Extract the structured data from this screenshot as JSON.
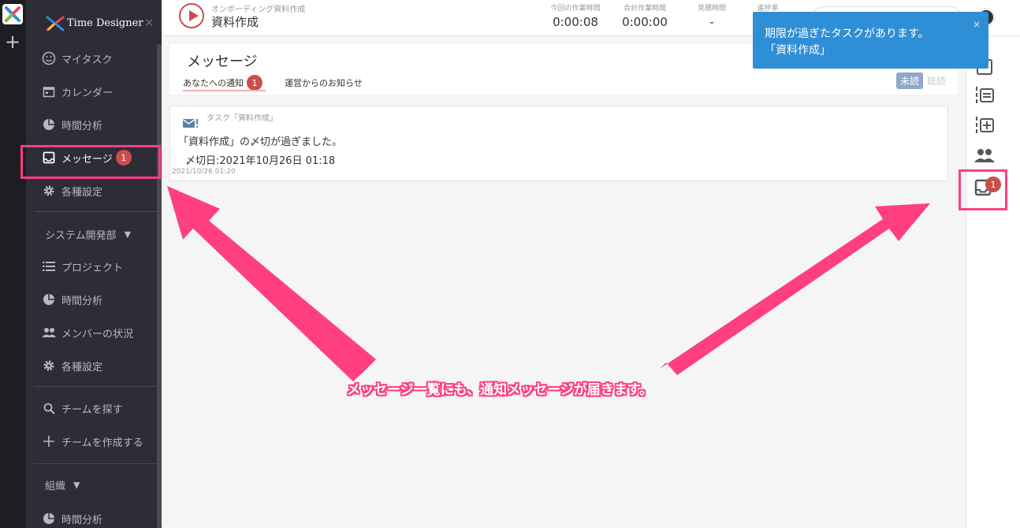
{
  "app": {
    "title": "Time Designer",
    "close_symbol": "✕",
    "add_symbol": "+"
  },
  "sidebar": {
    "items": [
      {
        "label": "マイタスク"
      },
      {
        "label": "カレンダー"
      },
      {
        "label": "時間分析"
      },
      {
        "label": "メッセージ",
        "badge": "1"
      },
      {
        "label": "各種設定"
      }
    ],
    "team_group": {
      "label": "システム開発部",
      "caret": "▼"
    },
    "team_items": [
      {
        "label": "プロジェクト"
      },
      {
        "label": "時間分析"
      },
      {
        "label": "メンバーの状況"
      },
      {
        "label": "各種設定"
      }
    ],
    "team_actions": [
      {
        "label": "チームを探す"
      },
      {
        "label": "チームを作成する"
      }
    ],
    "org_group": {
      "label": "組織",
      "caret": "▼"
    },
    "org_items": [
      {
        "label": "時間分析"
      }
    ]
  },
  "topbar": {
    "task_subtitle": "オンボーディング資料作成",
    "task_name": "資料作成",
    "stats": [
      {
        "label": "今回の作業時間",
        "value": "0:00:08"
      },
      {
        "label": "合計作業時間",
        "value": "0:00:00"
      },
      {
        "label": "見積時間",
        "value": "-"
      },
      {
        "label": "進捗率",
        "value": ""
      }
    ]
  },
  "messages": {
    "title": "メッセージ",
    "tabs": [
      {
        "label": "あなたへの通知",
        "badge": "1"
      },
      {
        "label": "運営からのお知らせ"
      }
    ],
    "filter": {
      "unread": "未読",
      "read": "既読"
    },
    "items": [
      {
        "task_ref": "タスク「資料作成」",
        "body": "「資料作成」の〆切が過ぎました。",
        "deadline": "〆切日:2021年10月26日 01:18",
        "timestamp": "2021/10/26 01:20"
      }
    ]
  },
  "rightbar": {
    "badge": "1"
  },
  "toast": {
    "line1": "期限が過ぎたタスクがあります。",
    "line2": "「資料作成」",
    "close": "×"
  },
  "annotation": {
    "caption": "メッセージ一覧にも、通知メッセージが届きます。",
    "color": "#ff3f7f"
  },
  "colors": {
    "sidebar": "#2d2c37",
    "accent": "#c8504b",
    "toast": "#2e8fd6"
  }
}
